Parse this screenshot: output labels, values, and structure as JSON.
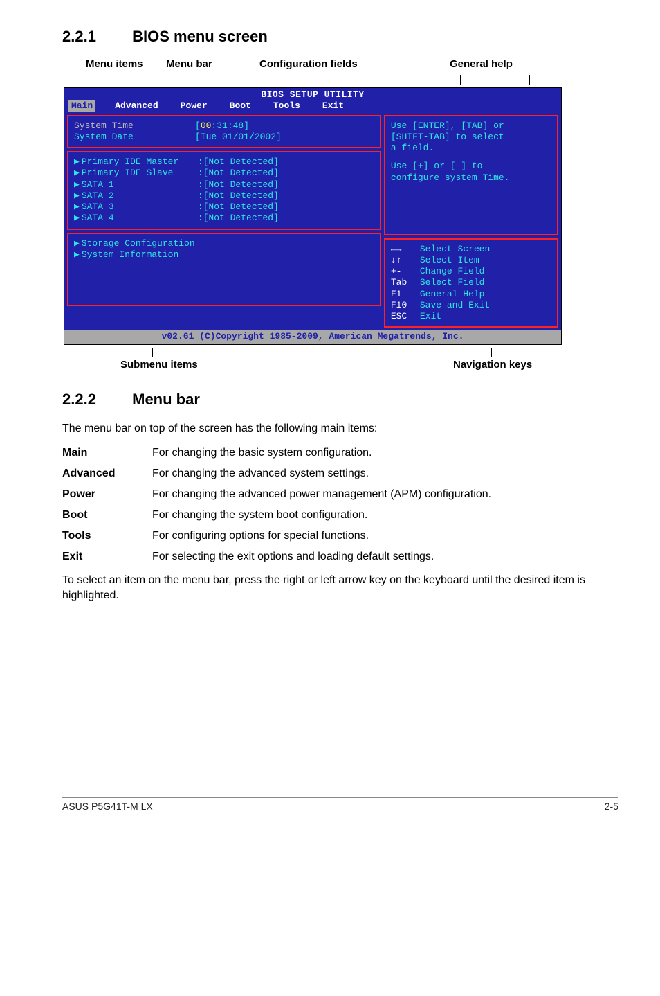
{
  "sec1": {
    "num": "2.2.1",
    "title": "BIOS menu screen"
  },
  "topLabels": {
    "l1": "Menu items",
    "l2": "Menu bar",
    "l3": "Configuration fields",
    "l4": "General help"
  },
  "biosTitle": "BIOS SETUP UTILITY",
  "menubar": {
    "main": "Main",
    "advanced": "Advanced",
    "power": "Power",
    "boot": "Boot",
    "tools": "Tools",
    "exit": "Exit"
  },
  "left": {
    "systemTimeLbl": "System Time",
    "systemTimeVal": "[00:31:48]",
    "systemDateLbl": "System Date",
    "systemDateVal": "[Tue 01/01/2002]",
    "pim": "Primary IDE Master",
    "pis": "Primary IDE Slave",
    "s1": "SATA 1",
    "s2": "SATA 2",
    "s3": "SATA 3",
    "s4": "SATA 4",
    "nd": ":[Not Detected]",
    "stor": "Storage Configuration",
    "sys": "System Information",
    "timeHH": "00"
  },
  "help": {
    "l1": "Use [ENTER], [TAB] or",
    "l2": "[SHIFT-TAB] to select",
    "l3": "a field.",
    "l4": "Use [+] or [-] to",
    "l5": "configure system Time."
  },
  "nav": {
    "k1": "←→",
    "v1": "Select Screen",
    "k2": "↓↑",
    "v2": "Select Item",
    "k3": "+-",
    "v3": "Change Field",
    "k4": "Tab",
    "v4": "Select Field",
    "k5": "F1",
    "v5": "General Help",
    "k6": "F10",
    "v6": "Save and Exit",
    "k7": "ESC",
    "v7": "Exit"
  },
  "biosFooter": "v02.61 (C)Copyright 1985-2009, American Megatrends, Inc.",
  "bottomLabels": {
    "l1": "Submenu items",
    "l2": "Navigation keys"
  },
  "sec2": {
    "num": "2.2.2",
    "title": "Menu bar"
  },
  "para1": "The menu bar on top of the screen has the following main items:",
  "defs": {
    "main": {
      "k": "Main",
      "v": "For changing the basic system configuration."
    },
    "advanced": {
      "k": "Advanced",
      "v": "For changing the advanced system settings."
    },
    "power": {
      "k": "Power",
      "v": "For changing the advanced power management (APM) configuration."
    },
    "boot": {
      "k": "Boot",
      "v": "For changing the system boot configuration."
    },
    "tools": {
      "k": "Tools",
      "v": "For configuring options for special functions."
    },
    "exit": {
      "k": "Exit",
      "v": "For selecting the exit options and loading default settings."
    }
  },
  "para2": "To select an item on the menu bar, press the right or left arrow key on the keyboard until the desired item is highlighted.",
  "footer": {
    "left": "ASUS P5G41T-M LX",
    "right": "2-5"
  }
}
